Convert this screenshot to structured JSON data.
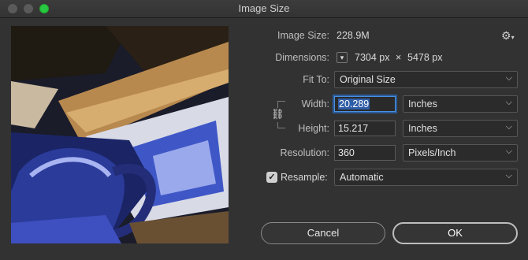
{
  "window": {
    "title": "Image Size"
  },
  "image_size": {
    "label": "Image Size:",
    "value": "228.9M"
  },
  "dimensions": {
    "label": "Dimensions:",
    "width": "7304 px",
    "separator": "×",
    "height": "5478 px"
  },
  "fit_to": {
    "label": "Fit To:",
    "value": "Original Size"
  },
  "width": {
    "label": "Width:",
    "value": "20.289",
    "unit": "Inches"
  },
  "height": {
    "label": "Height:",
    "value": "15.217",
    "unit": "Inches"
  },
  "resolution": {
    "label": "Resolution:",
    "value": "360",
    "unit": "Pixels/Inch"
  },
  "resample": {
    "label": "Resample:",
    "value": "Automatic",
    "checked": true
  },
  "buttons": {
    "cancel": "Cancel",
    "ok": "OK"
  },
  "icons": {
    "gear": "gear-icon",
    "link": "link-icon",
    "chevron": "chevron-icon"
  }
}
